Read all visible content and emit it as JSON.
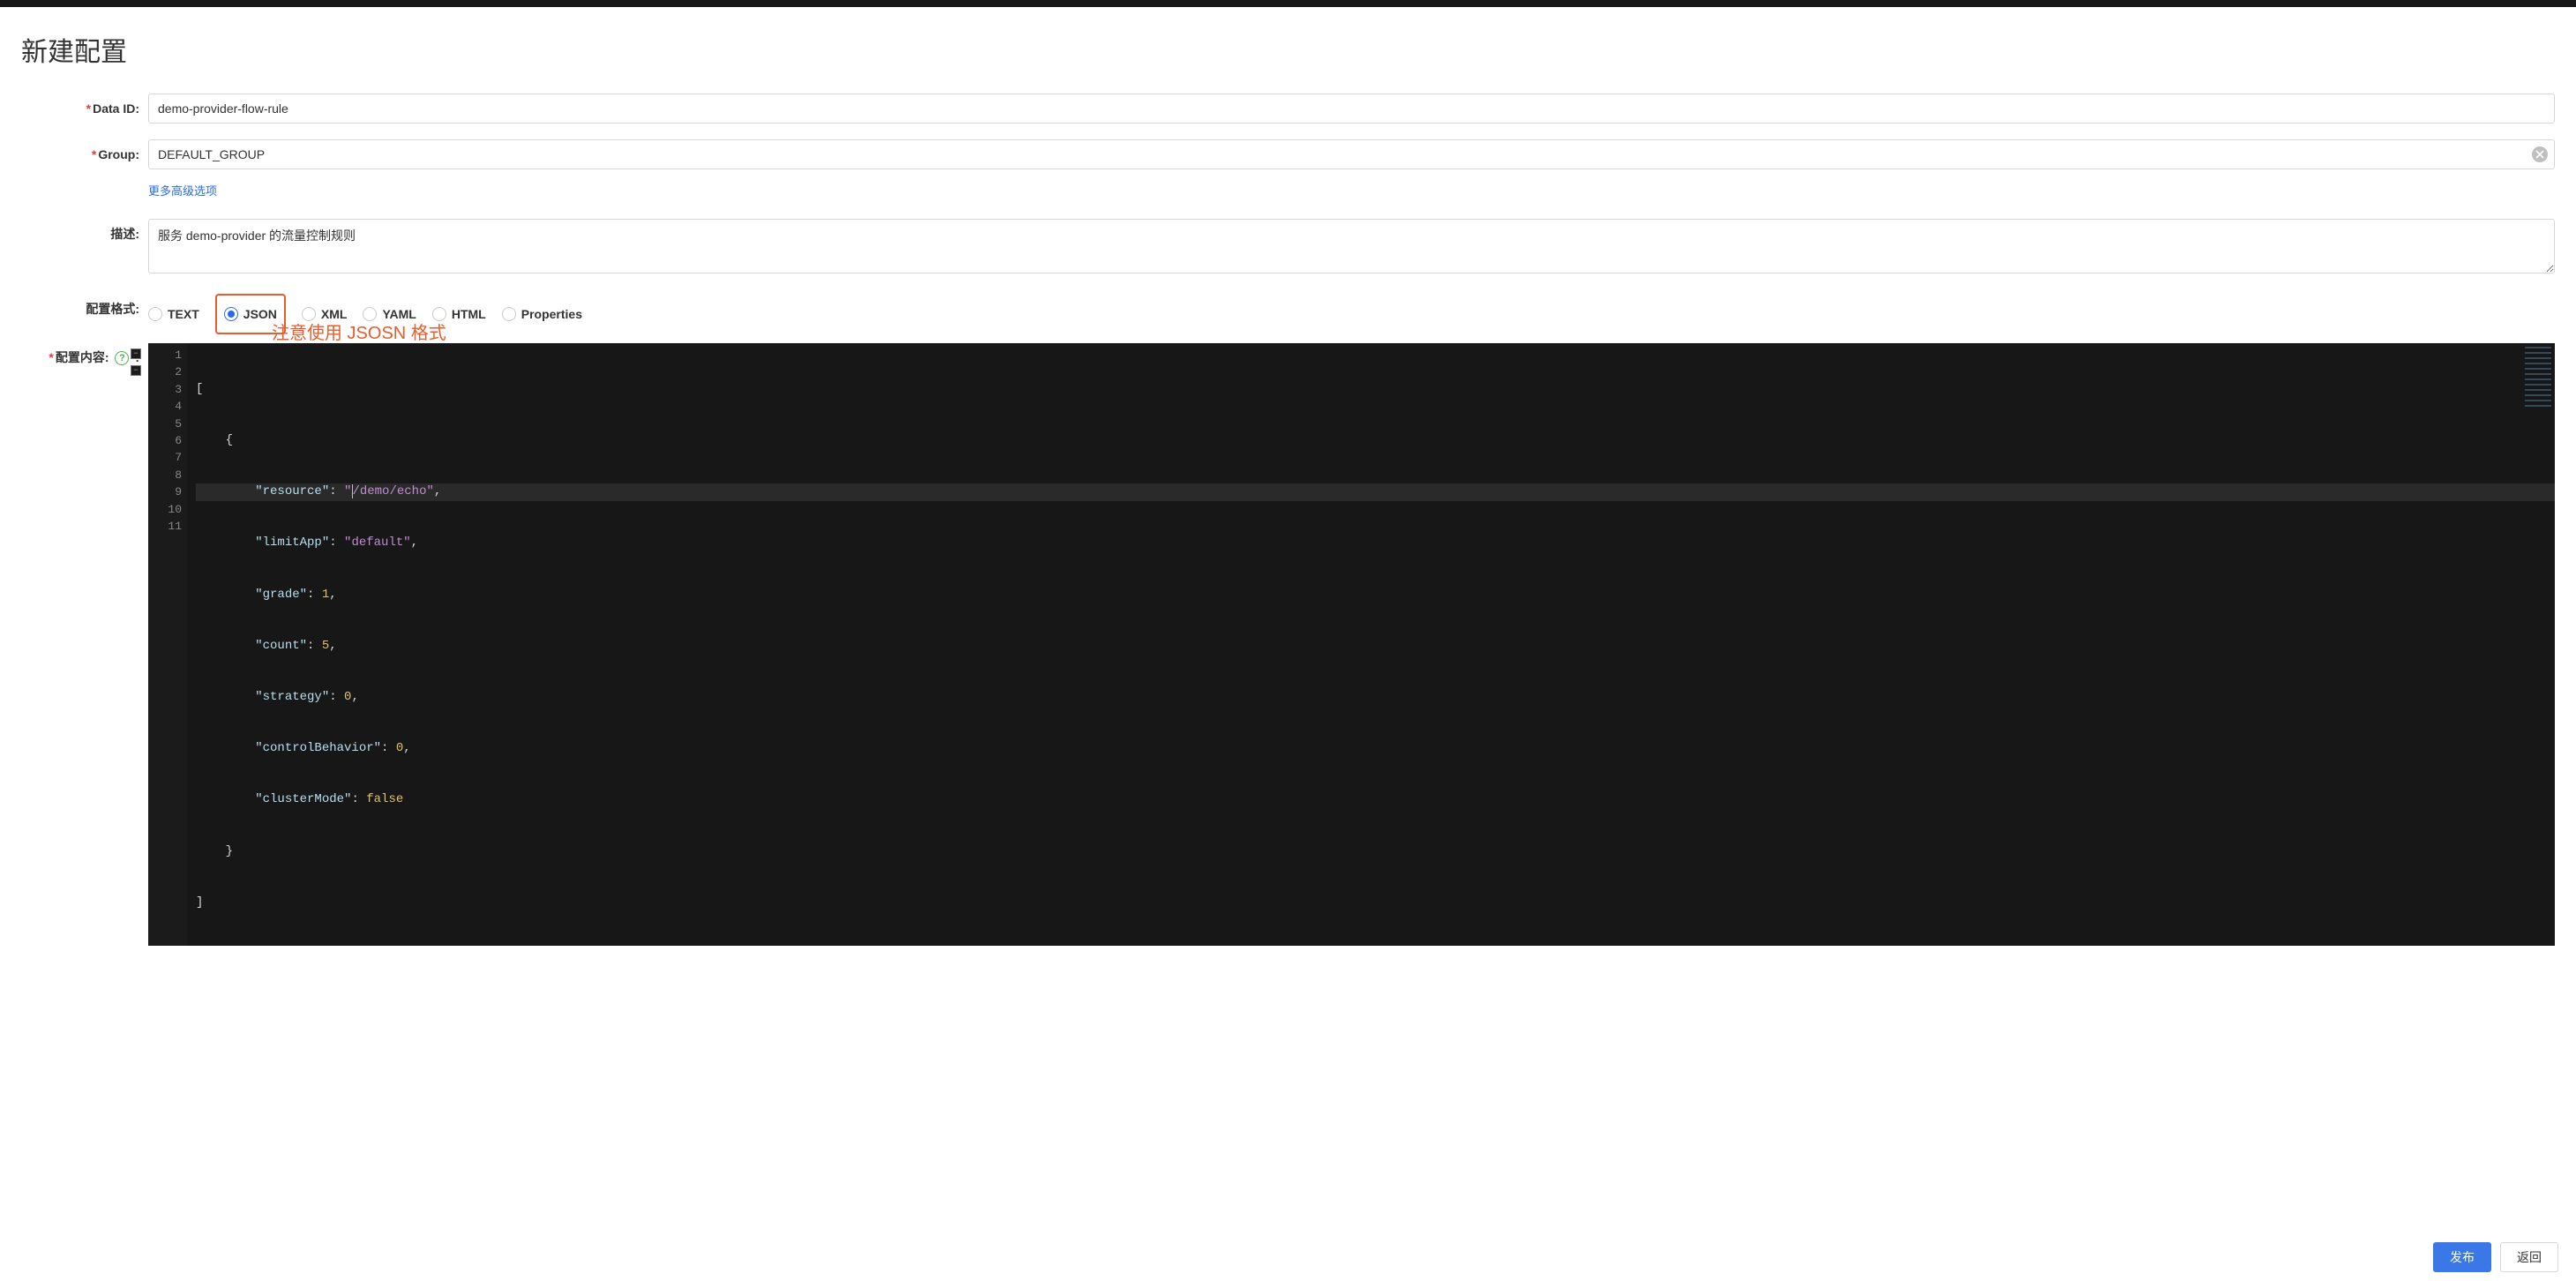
{
  "page": {
    "title": "新建配置"
  },
  "form": {
    "data_id": {
      "label": "Data ID:",
      "value": "demo-provider-flow-rule"
    },
    "group": {
      "label": "Group:",
      "value": "DEFAULT_GROUP"
    },
    "advanced_link": "更多高级选项",
    "description": {
      "label": "描述:",
      "value": "服务 demo-provider 的流量控制规则"
    },
    "format": {
      "label": "配置格式:",
      "options": [
        "TEXT",
        "JSON",
        "XML",
        "YAML",
        "HTML",
        "Properties"
      ],
      "selected": "JSON"
    },
    "content": {
      "label": "配置内容:"
    }
  },
  "annotation": "注意使用 JSOSN 格式",
  "editor": {
    "line_numbers": [
      "1",
      "2",
      "3",
      "4",
      "5",
      "6",
      "7",
      "8",
      "9",
      "10",
      "11"
    ],
    "content_json": [
      {
        "resource": "/demo/echo",
        "limitApp": "default",
        "grade": 1,
        "count": 5,
        "strategy": 0,
        "controlBehavior": 0,
        "clusterMode": false
      }
    ],
    "tokens": {
      "l1": {
        "p1": "["
      },
      "l2": {
        "p1": "{"
      },
      "l3": {
        "k": "\"resource\"",
        "c": ": ",
        "q1": "\"",
        "v": "/demo/echo",
        "q2": "\"",
        "t": ","
      },
      "l4": {
        "k": "\"limitApp\"",
        "c": ": ",
        "v": "\"default\"",
        "t": ","
      },
      "l5": {
        "k": "\"grade\"",
        "c": ": ",
        "v": "1",
        "t": ","
      },
      "l6": {
        "k": "\"count\"",
        "c": ": ",
        "v": "5",
        "t": ","
      },
      "l7": {
        "k": "\"strategy\"",
        "c": ": ",
        "v": "0",
        "t": ","
      },
      "l8": {
        "k": "\"controlBehavior\"",
        "c": ": ",
        "v": "0",
        "t": ","
      },
      "l9": {
        "k": "\"clusterMode\"",
        "c": ": ",
        "v": "false"
      },
      "l10": {
        "p1": "}"
      },
      "l11": {
        "p1": "]"
      }
    }
  },
  "footer": {
    "publish": "发布",
    "back": "返回"
  },
  "glyph": {
    "help": "?"
  }
}
